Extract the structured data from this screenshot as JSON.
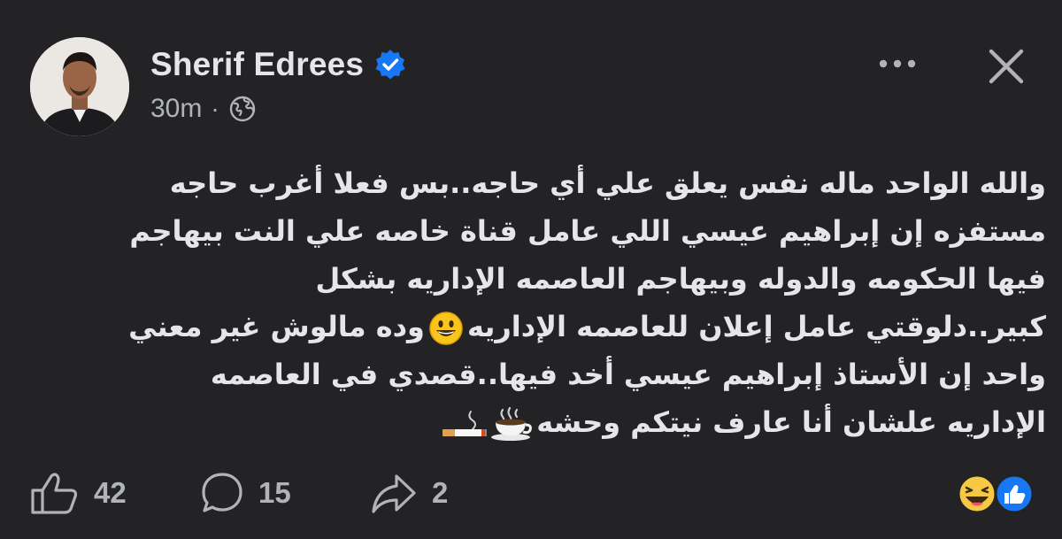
{
  "post": {
    "author_name": "Sherif Edrees",
    "timestamp": "30m",
    "separator": "·",
    "privacy_icon": "globe-icon",
    "verified_icon": "verified-badge-icon",
    "text_lines": [
      "والله الواحد ماله نفس يعلق علي أي حاجه..بس فعلا أغرب حاجه",
      "مستفزه إن إبراهيم عيسي اللي عامل قناة خاصه علي النت بيهاجم",
      "فيها الحكومه والدوله وبيهاجم العاصمه الإداريه بشكل",
      "كبير..دلوقتي عامل إعلان للعاصمه الإداريه",
      "وده مالوش غير معني",
      "واحد إن الأستاذ إبراهيم عيسي أخد فيها..قصدي في العاصمه",
      "الإداريه علشان أنا عارف نيتكم وحشه"
    ],
    "inline_emojis": [
      "grinning-face-emoji",
      "hot-beverage-emoji",
      "cigarette-emoji"
    ]
  },
  "footer": {
    "like_count": "42",
    "comment_count": "15",
    "share_count": "2",
    "reaction_icons": [
      "laughing-face-reaction-icon",
      "like-reaction-icon"
    ]
  },
  "colors": {
    "background": "#232325",
    "text_primary": "#e4e6eb",
    "text_secondary": "#b0b3b8",
    "verified_blue": "#1877f2"
  }
}
